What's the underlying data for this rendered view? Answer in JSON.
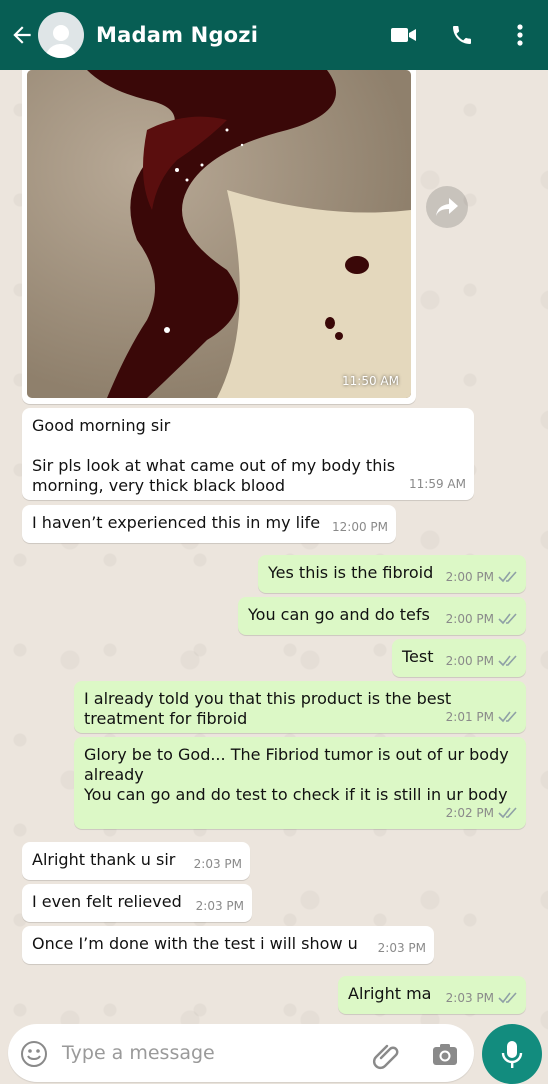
{
  "contact": {
    "name": "Madam Ngozi"
  },
  "image_message": {
    "time": "11:50 AM"
  },
  "messages": [
    {
      "text": [
        "Good morning sir",
        "",
        "Sir pls look at what came out of my body this morning, very thick black blood"
      ],
      "time": "11:59 AM"
    },
    {
      "text": [
        "I haven’t experienced this in my life"
      ],
      "time": "12:00 PM"
    },
    {
      "text": [
        "Yes this is the fibroid"
      ],
      "time": "2:00 PM"
    },
    {
      "text": [
        "You can go and do tefs"
      ],
      "time": "2:00 PM"
    },
    {
      "text": [
        "Test"
      ],
      "time": "2:00 PM"
    },
    {
      "text": [
        "I already told you that this product is the best treatment for fibroid"
      ],
      "time": "2:01 PM"
    },
    {
      "text": [
        "Glory be to God... The Fibriod tumor is out of ur body already",
        "You can go and do test to check if it is still in ur body"
      ],
      "time": "2:02 PM"
    },
    {
      "text": [
        "Alright thank u sir"
      ],
      "time": "2:03 PM"
    },
    {
      "text": [
        "I even felt relieved"
      ],
      "time": "2:03 PM"
    },
    {
      "text": [
        "Once I’m done with the test i will show u"
      ],
      "time": "2:03 PM"
    },
    {
      "text": [
        "Alright ma"
      ],
      "time": "2:03 PM"
    }
  ],
  "composer": {
    "placeholder": "Type a message"
  },
  "colors": {
    "header": "#075e54",
    "outgoing": "#dcf8c6",
    "incoming": "#ffffff",
    "mic": "#128c7e",
    "tick": "#8fa0a6"
  },
  "icons": [
    "back-arrow-icon",
    "avatar-icon",
    "video-call-icon",
    "phone-icon",
    "more-options-icon",
    "forward-icon",
    "double-tick-icon",
    "emoji-icon",
    "attach-icon",
    "camera-icon",
    "mic-icon"
  ]
}
